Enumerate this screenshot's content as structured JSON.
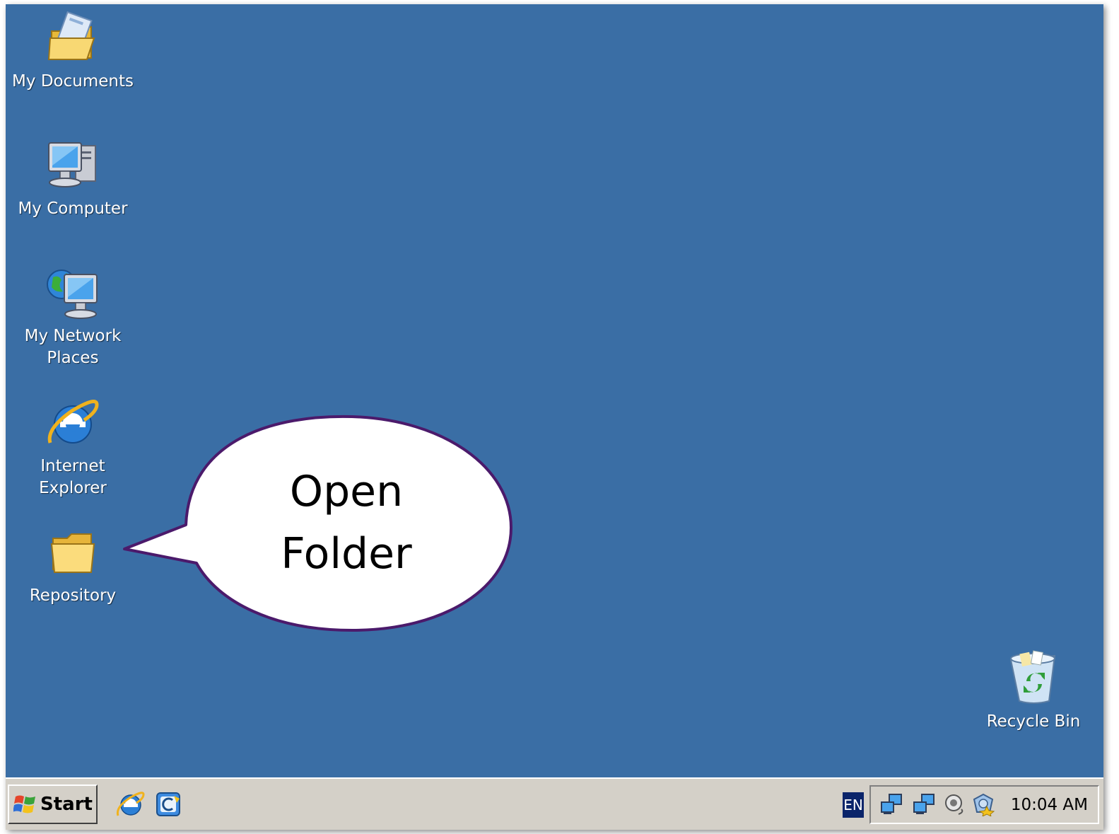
{
  "desktop": {
    "background_color": "#3a6ea5",
    "icons": [
      {
        "name": "my-documents",
        "label": "My Documents",
        "icon": "documents-folder-icon"
      },
      {
        "name": "my-computer",
        "label": "My Computer",
        "icon": "computer-icon"
      },
      {
        "name": "my-network-places",
        "label": "My Network Places",
        "icon": "network-places-icon"
      },
      {
        "name": "internet-explorer",
        "label": "Internet Explorer",
        "icon": "internet-explorer-icon"
      },
      {
        "name": "repository",
        "label": "Repository",
        "icon": "folder-icon"
      },
      {
        "name": "recycle-bin",
        "label": "Recycle Bin",
        "icon": "recycle-bin-icon"
      }
    ]
  },
  "callout": {
    "line1": "Open",
    "line2": "Folder",
    "fill": "#ffffff",
    "border_color": "#4b1a6b"
  },
  "taskbar": {
    "start_label": "Start",
    "quick_launch": [
      {
        "icon": "internet-explorer-icon"
      },
      {
        "icon": "outlook-express-icon"
      }
    ],
    "language": "EN",
    "tray_icons": [
      "network-icon",
      "network-icon",
      "volume-icon",
      "security-alert-icon"
    ],
    "clock": "10:04 AM"
  }
}
